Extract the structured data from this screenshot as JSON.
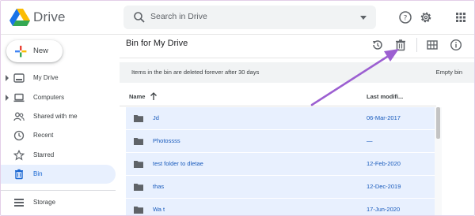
{
  "app": {
    "brand": "Drive"
  },
  "search": {
    "placeholder": "Search in Drive",
    "icon": "search-icon"
  },
  "header_icons": [
    "help-icon",
    "settings-icon",
    "apps-grid-icon"
  ],
  "sidebar": {
    "new_label": "New",
    "items": [
      {
        "label": "My Drive",
        "icon": "my-drive-icon",
        "expandable": true
      },
      {
        "label": "Computers",
        "icon": "computer-icon",
        "expandable": true
      },
      {
        "label": "Shared with me",
        "icon": "shared-icon",
        "expandable": false
      },
      {
        "label": "Recent",
        "icon": "clock-icon",
        "expandable": false
      },
      {
        "label": "Starred",
        "icon": "star-icon",
        "expandable": false
      },
      {
        "label": "Bin",
        "icon": "trash-icon",
        "expandable": false,
        "active": true
      },
      {
        "label": "Storage",
        "icon": "storage-icon",
        "expandable": false
      }
    ]
  },
  "main": {
    "title": "Bin for My Drive",
    "toolbar_icons": [
      "restore-icon",
      "trash-icon",
      "grid-view-icon",
      "info-icon"
    ],
    "banner_text": "Items in the bin are deleted forever after 30 days",
    "empty_bin_label": "Empty bin",
    "columns": {
      "name": "Name",
      "modified": "Last modifi..."
    },
    "rows": [
      {
        "name": "Jd",
        "modified": "06-Mar-2017"
      },
      {
        "name": "Photossss",
        "modified": "—"
      },
      {
        "name": "test folder to dletae",
        "modified": "12-Feb-2020"
      },
      {
        "name": "thas",
        "modified": "12-Dec-2019"
      },
      {
        "name": "Wa t",
        "modified": "17-Jun-2020"
      }
    ]
  },
  "colors": {
    "accent": "#1967d2",
    "selection": "#e8f0fe",
    "annotation_arrow": "#9c5fd1"
  }
}
